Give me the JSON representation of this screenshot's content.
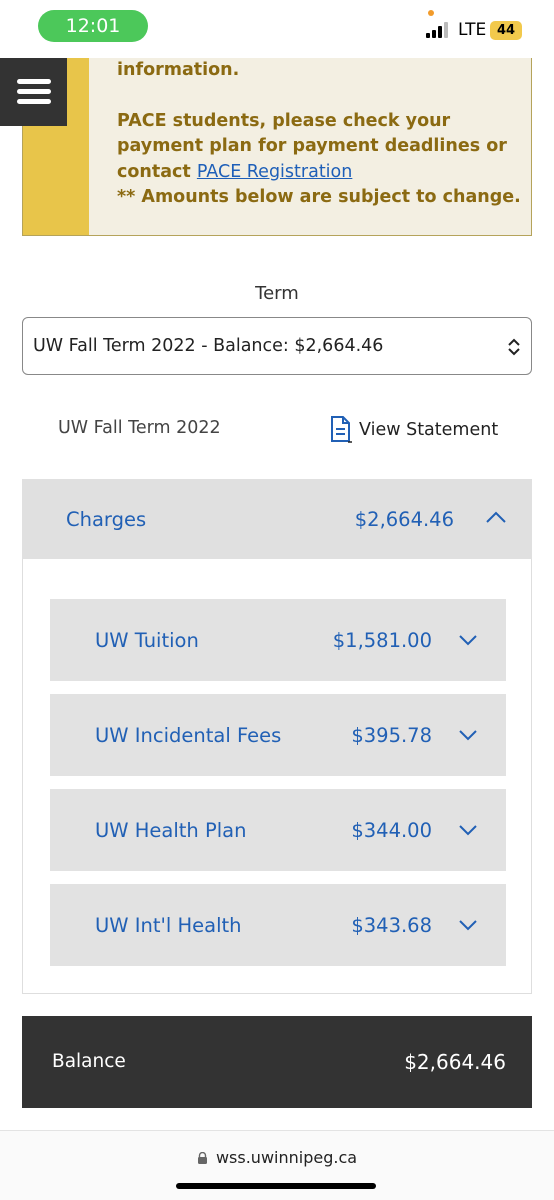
{
  "status_bar": {
    "time": "12:01",
    "network": "LTE",
    "battery": "44"
  },
  "notice": {
    "line_top": "information.",
    "pace_text": "PACE students, please check your payment plan for payment deadlines or contact",
    "pace_link": "PACE Registration",
    "amounts_note": "** Amounts below are subject to change."
  },
  "term": {
    "label": "Term",
    "selected": "UW Fall Term 2022 - Balance: $2,664.46",
    "name": "UW Fall Term 2022",
    "view_statement": "View Statement"
  },
  "charges": {
    "title": "Charges",
    "total": "$2,664.46",
    "items": [
      {
        "name": "UW Tuition",
        "amount": "$1,581.00"
      },
      {
        "name": "UW Incidental Fees",
        "amount": "$395.78"
      },
      {
        "name": "UW Health Plan",
        "amount": "$344.00"
      },
      {
        "name": "UW Int'l Health",
        "amount": "$343.68"
      }
    ]
  },
  "balance": {
    "label": "Balance",
    "amount": "$2,664.46"
  },
  "browser": {
    "url": "wss.uwinnipeg.ca"
  },
  "icons": {
    "menu": "hamburger-menu-icon",
    "document": "document-icon",
    "expand": "chevron-down-icon",
    "collapse": "chevron-up-icon",
    "lock": "lock-icon",
    "select": "select-arrows-icon"
  },
  "colors": {
    "link_blue": "#2160b5",
    "notice_text": "#8b6a12",
    "notice_accent": "#e8c54a",
    "dark_bar": "#333333"
  }
}
